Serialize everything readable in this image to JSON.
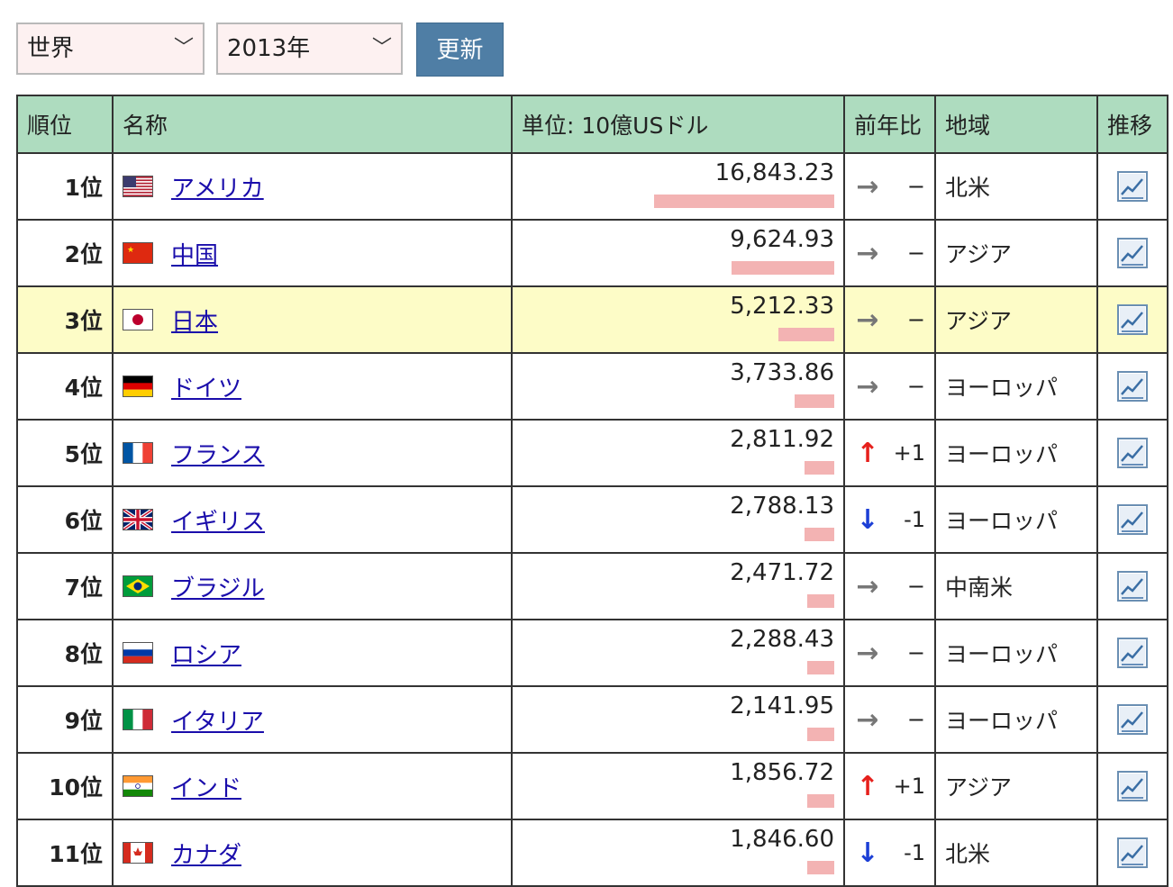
{
  "controls": {
    "region_value": "世界",
    "year_value": "2013年",
    "update_label": "更新"
  },
  "headers": {
    "rank": "順位",
    "name": "名称",
    "value": "単位: 10億USドル",
    "compare": "前年比",
    "region": "地域",
    "trend": "推移"
  },
  "rows": [
    {
      "rank": "1位",
      "flag": "us-flag-icon",
      "name": "アメリカ",
      "value": "16,843.23",
      "value_num": 16843.23,
      "arrow": "→",
      "arrow_type": "same",
      "compare": "−",
      "region": "北米",
      "highlight": false
    },
    {
      "rank": "2位",
      "flag": "cn-flag-icon",
      "name": "中国",
      "value": "9,624.93",
      "value_num": 9624.93,
      "arrow": "→",
      "arrow_type": "same",
      "compare": "−",
      "region": "アジア",
      "highlight": false
    },
    {
      "rank": "3位",
      "flag": "jp-flag-icon",
      "name": "日本",
      "value": "5,212.33",
      "value_num": 5212.33,
      "arrow": "→",
      "arrow_type": "same",
      "compare": "−",
      "region": "アジア",
      "highlight": true
    },
    {
      "rank": "4位",
      "flag": "de-flag-icon",
      "name": "ドイツ",
      "value": "3,733.86",
      "value_num": 3733.86,
      "arrow": "→",
      "arrow_type": "same",
      "compare": "−",
      "region": "ヨーロッパ",
      "highlight": false
    },
    {
      "rank": "5位",
      "flag": "fr-flag-icon",
      "name": "フランス",
      "value": "2,811.92",
      "value_num": 2811.92,
      "arrow": "↑",
      "arrow_type": "up",
      "compare": "+1",
      "region": "ヨーロッパ",
      "highlight": false
    },
    {
      "rank": "6位",
      "flag": "gb-flag-icon",
      "name": "イギリス",
      "value": "2,788.13",
      "value_num": 2788.13,
      "arrow": "↓",
      "arrow_type": "down",
      "compare": "-1",
      "region": "ヨーロッパ",
      "highlight": false
    },
    {
      "rank": "7位",
      "flag": "br-flag-icon",
      "name": "ブラジル",
      "value": "2,471.72",
      "value_num": 2471.72,
      "arrow": "→",
      "arrow_type": "same",
      "compare": "−",
      "region": "中南米",
      "highlight": false
    },
    {
      "rank": "8位",
      "flag": "ru-flag-icon",
      "name": "ロシア",
      "value": "2,288.43",
      "value_num": 2288.43,
      "arrow": "→",
      "arrow_type": "same",
      "compare": "−",
      "region": "ヨーロッパ",
      "highlight": false
    },
    {
      "rank": "9位",
      "flag": "it-flag-icon",
      "name": "イタリア",
      "value": "2,141.95",
      "value_num": 2141.95,
      "arrow": "→",
      "arrow_type": "same",
      "compare": "−",
      "region": "ヨーロッパ",
      "highlight": false
    },
    {
      "rank": "10位",
      "flag": "in-flag-icon",
      "name": "インド",
      "value": "1,856.72",
      "value_num": 1856.72,
      "arrow": "↑",
      "arrow_type": "up",
      "compare": "+1",
      "region": "アジア",
      "highlight": false
    },
    {
      "rank": "11位",
      "flag": "ca-flag-icon",
      "name": "カナダ",
      "value": "1,846.60",
      "value_num": 1846.6,
      "arrow": "↓",
      "arrow_type": "down",
      "compare": "-1",
      "region": "北米",
      "highlight": false
    }
  ],
  "colors": {
    "header_bg": "#aedcbf",
    "highlight_bg": "#fdfcc7",
    "bar": "#f3b3b3",
    "button": "#4f7ea5",
    "link": "#1a0dab",
    "up": "#e6201c",
    "down": "#1c3fd6"
  }
}
